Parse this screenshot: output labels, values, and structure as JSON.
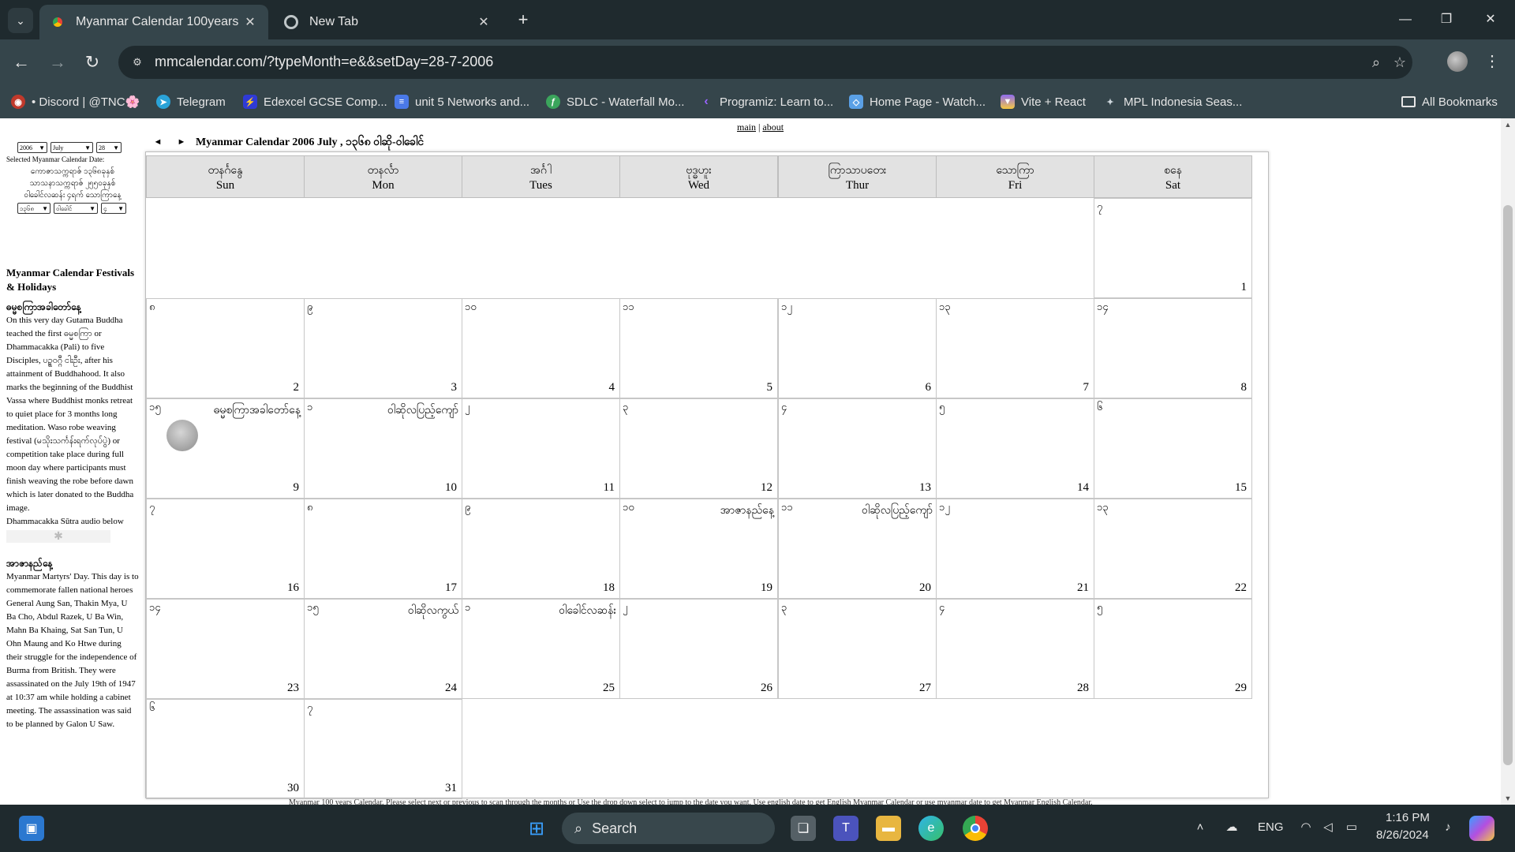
{
  "browser": {
    "tabs": [
      {
        "title": "Myanmar Calendar 100years",
        "active": true
      },
      {
        "title": "New Tab",
        "active": false
      }
    ],
    "url": "mmcalendar.com/?typeMonth=e&&setDay=28-7-2006",
    "bookmarks": [
      {
        "label": "• Discord | @TNC🌸",
        "icon": "discord-icon",
        "color": "#c0392b"
      },
      {
        "label": "Telegram",
        "icon": "telegram-icon",
        "color": "#2aa3d8"
      },
      {
        "label": "Edexcel GCSE Comp...",
        "icon": "edexcel-icon",
        "color": "#2f3ad6"
      },
      {
        "label": "unit 5 Networks and...",
        "icon": "docs-icon",
        "color": "#4a79e8"
      },
      {
        "label": "SDLC - Waterfall Mo...",
        "icon": "sdlc-icon",
        "color": "#3ba55c"
      },
      {
        "label": "Programiz: Learn to...",
        "icon": "programiz-icon",
        "color": "#7a3ff2"
      },
      {
        "label": "Home Page - Watch...",
        "icon": "watch-icon",
        "color": "#5aa0e6"
      },
      {
        "label": "Vite + React",
        "icon": "vite-icon",
        "color": "#8f6cf0"
      },
      {
        "label": "MPL Indonesia Seas...",
        "icon": "mpl-icon",
        "color": "#8fa0b0"
      }
    ],
    "all_bookmarks": "All Bookmarks"
  },
  "page": {
    "links": {
      "main": "main",
      "about": "about"
    },
    "selectors": {
      "year": "2006",
      "month": "July",
      "day": "28",
      "caption": "Selected Myanmar Calendar Date:",
      "myanmar_date_lines": [
        "ကောဇာသက္ကရာဇ် ၁၃၆၈ခုနှစ်",
        "သာသနာသက္ကရာဇ် ၂၅၅၀ခုနှစ်",
        "ဝါခေါင်လဆန်း ၄ရက် သောကြာနေ့"
      ],
      "my_year": "၁၃၆၈",
      "my_month": "ဝါခေါင်",
      "my_day": "၄"
    },
    "header": {
      "prev": "◄",
      "next": "►",
      "title": "Myanmar Calendar 2006 July ,  ၁၃၆၈ ဝါဆို-ဝါခေါင်"
    },
    "festivals_heading": "Myanmar Calendar Festivals & Holidays",
    "festivals": [
      {
        "title": "ဓမ္မစကြာအခါတော်နေ့",
        "text": "On this very day Gutama Buddha teached the first ဓမ္မစကြာ or Dhammacakka (Pali) to five Disciples, ပဥ္စဝဂ္ဂီ ငါးဦး, after his attainment of Buddhahood. It also marks the beginning of the Buddhist Vassa where Buddhist monks retreat to quiet place for 3 months long meditation. Waso robe weaving festival (မသိုးသင်္ကန်းရက်လုပ်ပွဲ) or competition take place during full moon day where participants must finish weaving the robe before dawn which is later donated to the Buddha image.",
        "audio_note": "Dhammacakka Sūtra audio below"
      },
      {
        "title": "အာဇာနည်နေ့",
        "text": "Myanmar Martyrs' Day. This day is to commemorate fallen national heroes General Aung San, Thakin Mya, U Ba Cho, Abdul Razek, U Ba Win, Mahn Ba Khaing, Sat San Tun, U Ohn Maung and Ko Htwe during their struggle for the independence of Burma from British. They were assassinated on the July 19th of 1947 at 10:37 am while holding a cabinet meeting. The assassination was said to be planned by Galon U Saw."
      }
    ],
    "weekdays": [
      {
        "my": "တနင်္ဂနွေ",
        "en": "Sun"
      },
      {
        "my": "တနင်္လာ",
        "en": "Mon"
      },
      {
        "my": "အင်္ဂါ",
        "en": "Tues"
      },
      {
        "my": "ဗုဒ္ဓဟူး",
        "en": "Wed"
      },
      {
        "my": "ကြာသာပတေး",
        "en": "Thur"
      },
      {
        "my": "သောကြာ",
        "en": "Fri"
      },
      {
        "my": "စနေ",
        "en": "Sat"
      }
    ],
    "days": [
      {
        "day": "1",
        "mm": "၇",
        "event": ""
      },
      {
        "day": "2",
        "mm": "၈",
        "event": ""
      },
      {
        "day": "3",
        "mm": "၉",
        "event": ""
      },
      {
        "day": "4",
        "mm": "၁၀",
        "event": ""
      },
      {
        "day": "5",
        "mm": "၁၁",
        "event": ""
      },
      {
        "day": "6",
        "mm": "၁၂",
        "event": ""
      },
      {
        "day": "7",
        "mm": "၁၃",
        "event": ""
      },
      {
        "day": "8",
        "mm": "၁၄",
        "event": ""
      },
      {
        "day": "9",
        "mm": "၁၅",
        "event": "ဓမ္မစကြာအခါတော်နေ့",
        "full_moon": true
      },
      {
        "day": "10",
        "mm": "၁",
        "event": "ဝါဆိုလပြည့်ကျော်"
      },
      {
        "day": "11",
        "mm": "၂",
        "event": ""
      },
      {
        "day": "12",
        "mm": "၃",
        "event": ""
      },
      {
        "day": "13",
        "mm": "၄",
        "event": ""
      },
      {
        "day": "14",
        "mm": "၅",
        "event": ""
      },
      {
        "day": "15",
        "mm": "၆",
        "event": ""
      },
      {
        "day": "16",
        "mm": "၇",
        "event": ""
      },
      {
        "day": "17",
        "mm": "၈",
        "event": ""
      },
      {
        "day": "18",
        "mm": "၉",
        "event": ""
      },
      {
        "day": "19",
        "mm": "၁၀",
        "event": "အာဇာနည်နေ့"
      },
      {
        "day": "20",
        "mm": "၁၁",
        "event": "ဝါဆိုလပြည့်ကျော်"
      },
      {
        "day": "21",
        "mm": "၁၂",
        "event": ""
      },
      {
        "day": "22",
        "mm": "၁၃",
        "event": ""
      },
      {
        "day": "23",
        "mm": "၁၄",
        "event": ""
      },
      {
        "day": "24",
        "mm": "၁၅",
        "event": "ဝါဆိုလကွယ်"
      },
      {
        "day": "25",
        "mm": "၁",
        "event": "ဝါခေါင်လဆန်း"
      },
      {
        "day": "26",
        "mm": "၂",
        "event": ""
      },
      {
        "day": "27",
        "mm": "၃",
        "event": ""
      },
      {
        "day": "28",
        "mm": "၄",
        "event": ""
      },
      {
        "day": "29",
        "mm": "၅",
        "event": ""
      },
      {
        "day": "30",
        "mm": "၆",
        "event": ""
      },
      {
        "day": "31",
        "mm": "၇",
        "event": ""
      }
    ],
    "footer_note": "Myanmar 100 years Calendar. Please select next or previous to scan through the months or Use the drop down select to jump to the date you want. Use english date to get English Myanmar Calendar or use myanmar date to get Myanmar English Calendar."
  },
  "taskbar": {
    "search_placeholder": "Search",
    "language": "ENG",
    "time": "1:16 PM",
    "date": "8/26/2024"
  }
}
